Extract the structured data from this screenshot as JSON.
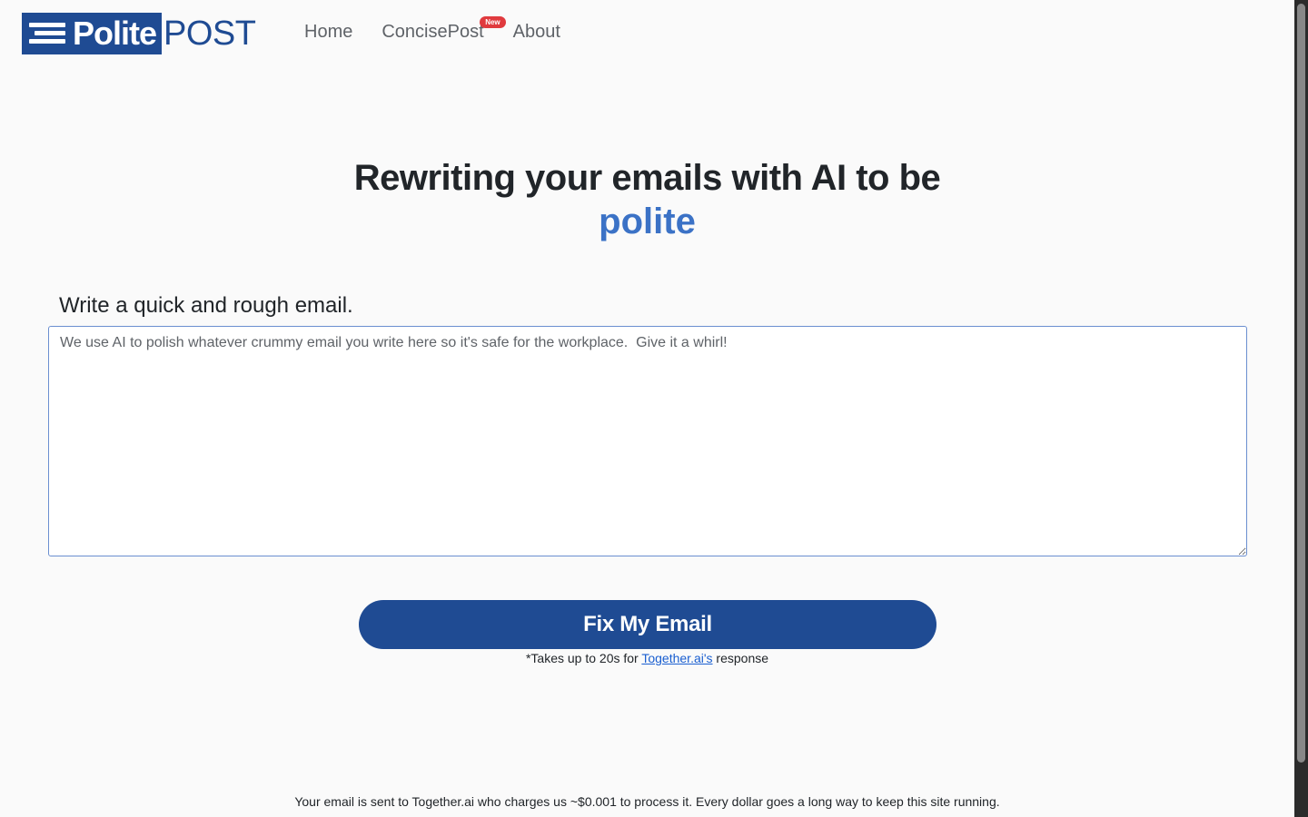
{
  "header": {
    "logo": {
      "polite": "Polite",
      "post": "POST"
    },
    "nav": {
      "home": "Home",
      "concise": "ConcisePost",
      "concise_badge": "New",
      "about": "About"
    }
  },
  "hero": {
    "title": "Rewriting your emails with AI to be",
    "accent": "polite"
  },
  "form": {
    "label": "Write a quick and rough email.",
    "placeholder": "We use AI to polish whatever crummy email you write here so it's safe for the workplace.  Give it a whirl!",
    "button": "Fix My Email",
    "note_prefix": "*Takes up to 20s for ",
    "note_link": "Together.ai's",
    "note_suffix": " response"
  },
  "footer": {
    "text": "Your email is sent to Together.ai who charges us ~$0.001 to process it. Every dollar goes a long way to keep this site running."
  },
  "colors": {
    "brand": "#1f4b93",
    "accent": "#3b72c6",
    "badge": "#e03a3e",
    "background": "#fafafa"
  }
}
